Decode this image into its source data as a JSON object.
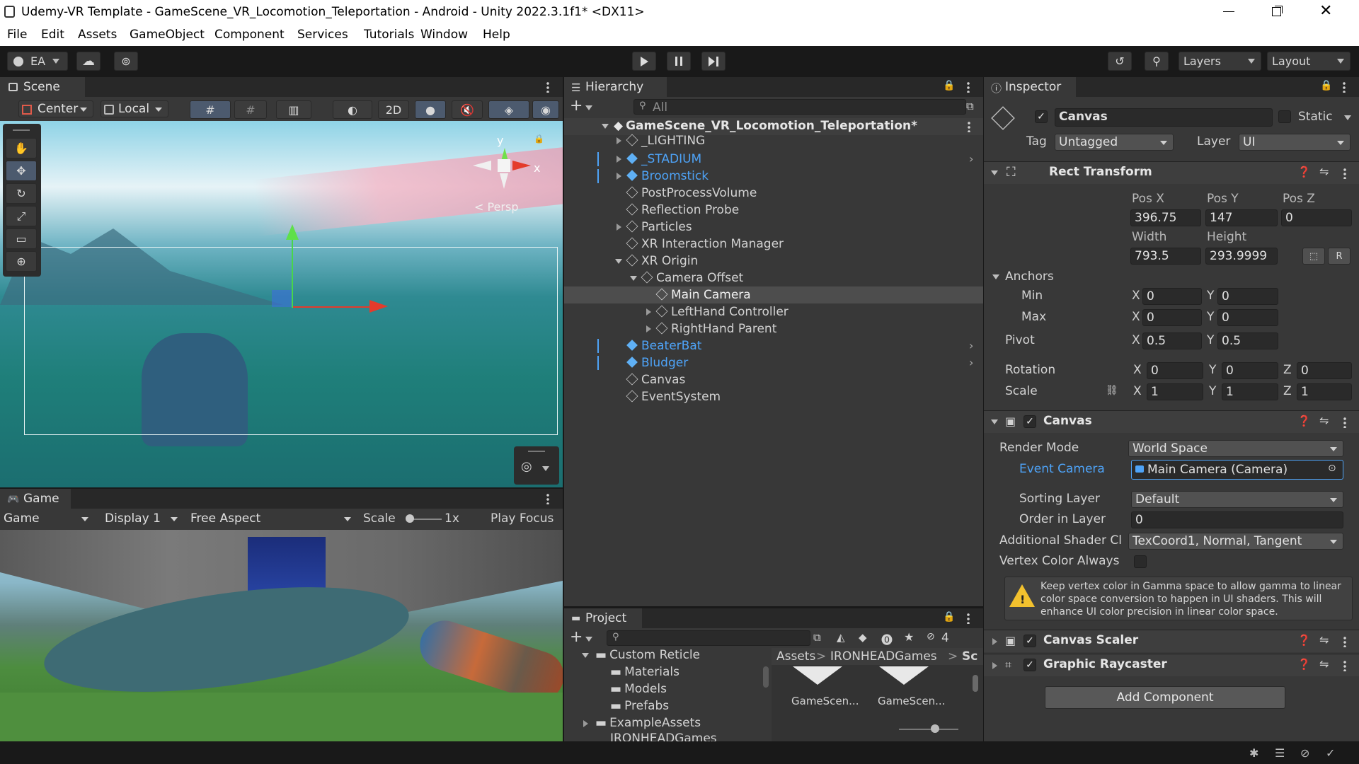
{
  "window": {
    "title": "Udemy-VR Template - GameScene_VR_Locomotion_Teleportation - Android - Unity 2022.3.1f1* <DX11>",
    "controls": [
      "minimize",
      "maximize",
      "close"
    ]
  },
  "menu": [
    "File",
    "Edit",
    "Assets",
    "GameObject",
    "Component",
    "Services",
    "Tutorials",
    "Window",
    "Help"
  ],
  "toolbar": {
    "account": "EA",
    "layers_label": "Layers",
    "layout_label": "Layout"
  },
  "scene": {
    "tab": "Scene",
    "pivot": "Center",
    "space": "Local",
    "mode_2d": "2D",
    "gizmo_y": "y",
    "gizmo_x": "x",
    "persp": "< Persp"
  },
  "game": {
    "tab": "Game",
    "view_select": "Game",
    "display": "Display 1",
    "aspect": "Free Aspect",
    "scale_label": "Scale",
    "scale_value": "1x",
    "play_focus": "Play Focus"
  },
  "hierarchy": {
    "tab": "Hierarchy",
    "search_placeholder": "All",
    "scene_name": "GameScene_VR_Locomotion_Teleportation*",
    "items": [
      {
        "label": "_LIGHTING",
        "prefab": false,
        "expandable": true
      },
      {
        "label": "_STADIUM",
        "prefab": true,
        "expandable": true
      },
      {
        "label": "Broomstick",
        "prefab": true,
        "expandable": true
      },
      {
        "label": "PostProcessVolume",
        "prefab": false,
        "expandable": false
      },
      {
        "label": "Reflection Probe",
        "prefab": false,
        "expandable": false
      },
      {
        "label": "Particles",
        "prefab": false,
        "expandable": true
      },
      {
        "label": "XR Interaction Manager",
        "prefab": false,
        "expandable": false
      },
      {
        "label": "XR Origin",
        "prefab": false,
        "expandable": true
      },
      {
        "label": "Camera Offset",
        "prefab": false,
        "expandable": true
      },
      {
        "label": "Main Camera",
        "prefab": false,
        "expandable": false
      },
      {
        "label": "LeftHand Controller",
        "prefab": false,
        "expandable": true
      },
      {
        "label": "RightHand Parent",
        "prefab": false,
        "expandable": true
      },
      {
        "label": "BeaterBat",
        "prefab": true,
        "expandable": false
      },
      {
        "label": "Bludger",
        "prefab": true,
        "expandable": false
      },
      {
        "label": "Canvas",
        "prefab": false,
        "expandable": false
      },
      {
        "label": "EventSystem",
        "prefab": false,
        "expandable": false
      }
    ]
  },
  "project": {
    "tab": "Project",
    "hidden_count": "4",
    "tree": [
      "Custom Reticle",
      "Materials",
      "Models",
      "Prefabs",
      "ExampleAssets",
      "IRONHEADGames"
    ],
    "breadcrumb": [
      "Assets",
      ">",
      "IRONHEADGames",
      ">",
      "Sc"
    ],
    "assets": [
      "GameScen...",
      "GameScen..."
    ]
  },
  "inspector": {
    "tab": "Inspector",
    "object_name": "Canvas",
    "static_label": "Static",
    "tag_label": "Tag",
    "tag_value": "Untagged",
    "layer_label": "Layer",
    "layer_value": "UI",
    "rect_transform": {
      "title": "Rect Transform",
      "pos_x_label": "Pos X",
      "pos_y_label": "Pos Y",
      "pos_z_label": "Pos Z",
      "pos_x": "396.75",
      "pos_y": "147",
      "pos_z": "0",
      "width_label": "Width",
      "height_label": "Height",
      "width": "793.5",
      "height": "293.9999",
      "raw_btn": "R",
      "anchors_label": "Anchors",
      "min_label": "Min",
      "max_label": "Max",
      "pivot_label": "Pivot",
      "x": "X",
      "y": "Y",
      "z": "Z",
      "min_x": "0",
      "min_y": "0",
      "max_x": "0",
      "max_y": "0",
      "pivot_x": "0.5",
      "pivot_y": "0.5",
      "rotation_label": "Rotation",
      "rot_x": "0",
      "rot_y": "0",
      "rot_z": "0",
      "scale_label": "Scale",
      "scale_x": "1",
      "scale_y": "1",
      "scale_z": "1"
    },
    "canvas": {
      "title": "Canvas",
      "render_mode_label": "Render Mode",
      "render_mode": "World Space",
      "event_camera_label": "Event Camera",
      "event_camera": "Main Camera (Camera)",
      "sorting_layer_label": "Sorting Layer",
      "sorting_layer": "Default",
      "order_label": "Order in Layer",
      "order": "0",
      "shader_label": "Additional Shader Cl",
      "shader": "TexCoord1, Normal, Tangent",
      "vertex_label": "Vertex Color Always",
      "warning": "Keep vertex color in Gamma space to allow gamma to linear color space conversion to happen in UI shaders. This will enhance UI color precision in linear color space."
    },
    "canvas_scaler": "Canvas Scaler",
    "graphic_raycaster": "Graphic Raycaster",
    "add_component": "Add Component"
  },
  "colors": {
    "accent_blue": "#4ea3f7",
    "panel": "#383838",
    "selection": "#4d4d4d"
  }
}
